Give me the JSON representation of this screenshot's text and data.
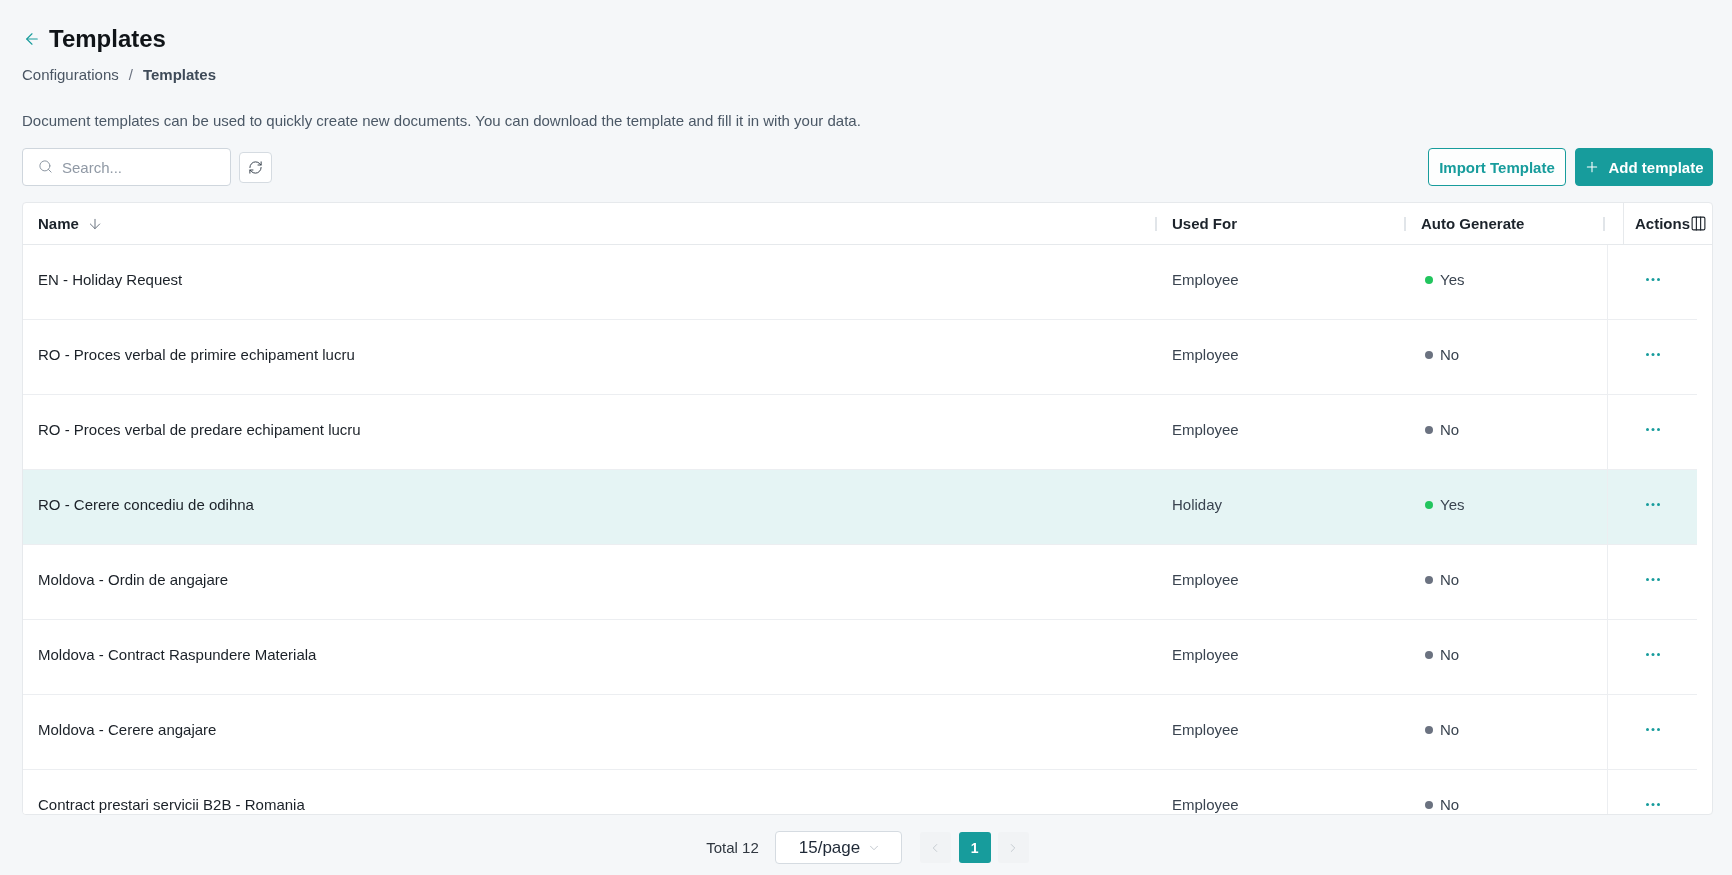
{
  "header": {
    "title": "Templates"
  },
  "breadcrumb": {
    "separator": "/",
    "items": [
      {
        "label": "Configurations",
        "current": false
      },
      {
        "label": "Templates",
        "current": true
      }
    ]
  },
  "description": "Document templates can be used to quickly create new documents. You can download the template and fill it in with your data.",
  "toolbar": {
    "search": {
      "placeholder": "Search..."
    },
    "buttons": [
      {
        "kind": "outline",
        "label": "Import Template"
      },
      {
        "kind": "primary",
        "label": "Add template"
      }
    ]
  },
  "table": {
    "columns": [
      {
        "label": "Name",
        "sort_descending": true
      },
      {
        "label": "Used For"
      },
      {
        "label": "Auto Generate"
      },
      {
        "label": "Actions"
      }
    ],
    "rows": [
      {
        "name": "EN - Holiday Request",
        "used_for": "Employee",
        "auto_generate": {
          "label": "Yes",
          "color": "#22c55e"
        },
        "selected": false
      },
      {
        "name": "RO - Proces verbal de primire echipament lucru",
        "used_for": "Employee",
        "auto_generate": {
          "label": "No",
          "color": "#6b7280"
        },
        "selected": false
      },
      {
        "name": "RO - Proces verbal de predare echipament lucru",
        "used_for": "Employee",
        "auto_generate": {
          "label": "No",
          "color": "#6b7280"
        },
        "selected": false
      },
      {
        "name": "RO - Cerere concediu de odihna",
        "used_for": "Holiday",
        "auto_generate": {
          "label": "Yes",
          "color": "#22c55e"
        },
        "selected": true
      },
      {
        "name": "Moldova - Ordin de angajare",
        "used_for": "Employee",
        "auto_generate": {
          "label": "No",
          "color": "#6b7280"
        },
        "selected": false
      },
      {
        "name": "Moldova - Contract Raspundere Materiala",
        "used_for": "Employee",
        "auto_generate": {
          "label": "No",
          "color": "#6b7280"
        },
        "selected": false
      },
      {
        "name": "Moldova - Cerere angajare",
        "used_for": "Employee",
        "auto_generate": {
          "label": "No",
          "color": "#6b7280"
        },
        "selected": false
      },
      {
        "name": "Contract prestari servicii B2B - Romania",
        "used_for": "Employee",
        "auto_generate": {
          "label": "No",
          "color": "#6b7280"
        },
        "selected": false
      }
    ]
  },
  "pagination": {
    "total": "Total 12",
    "page_size": "15/page",
    "prev_disabled": true,
    "next_disabled": true,
    "pages": [
      {
        "label": "1",
        "selected": true
      }
    ]
  }
}
